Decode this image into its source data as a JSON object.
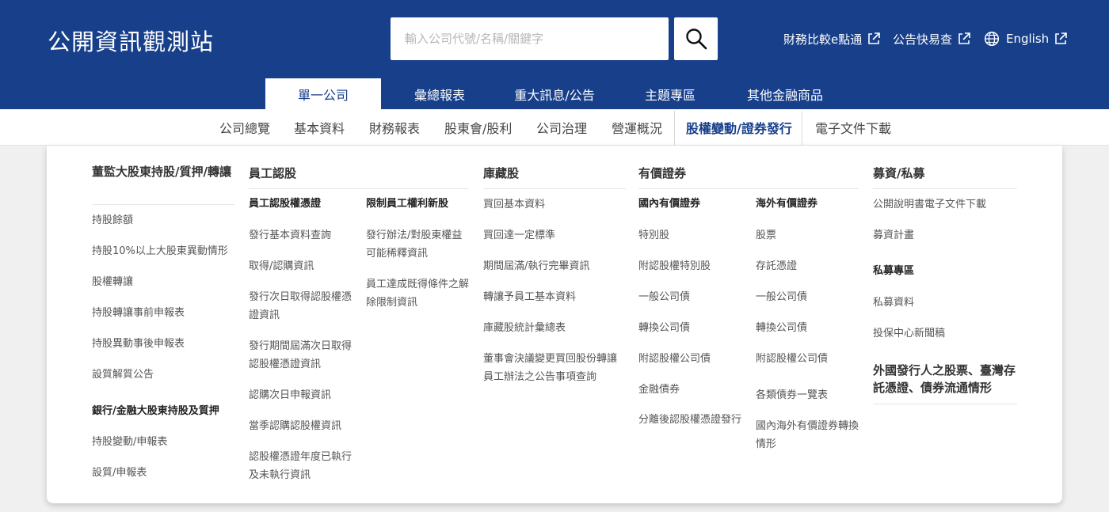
{
  "header": {
    "logo": "公開資訊觀測站",
    "search_placeholder": "輸入公司代號/名稱/關鍵字",
    "links": [
      "財務比較e點通",
      "公告快易查",
      "English"
    ]
  },
  "main_tabs": [
    "單一公司",
    "彙總報表",
    "重大訊息/公告",
    "主題專區",
    "其他金融商品"
  ],
  "sub_tabs": [
    "公司總覽",
    "基本資料",
    "財務報表",
    "股東會/股利",
    "公司治理",
    "營運概況",
    "股權變動/證券發行",
    "電子文件下載"
  ],
  "menu": {
    "col1": {
      "title": "董監大股東持股/質押/轉讓",
      "items": [
        "持股餘額",
        "持股10%以上大股東異動情形",
        "股權轉讓",
        "持股轉讓事前申報表",
        "持股異動事後申報表",
        "設質解質公告"
      ],
      "sub_title": "銀行/金融大股東持股及質押",
      "sub_items": [
        "持股變動/申報表",
        "設質/申報表"
      ]
    },
    "col2": {
      "title": "員工認股",
      "left_title": "員工認股權憑證",
      "left_items": [
        "發行基本資料查詢",
        "取得/認購資訊",
        "發行次日取得認股權憑證資訊",
        "發行期間屆滿次日取得認股權憑證資訊",
        "認購次日申報資訊",
        "當季認購認股權資訊",
        "認股權憑證年度已執行及未執行資訊"
      ],
      "right_title": "限制員工權利新股",
      "right_items": [
        "發行辦法/對股東權益可能稀釋資訊",
        "員工達成既得條件之解除限制資訊"
      ]
    },
    "col3": {
      "title": "庫藏股",
      "items": [
        "買回基本資料",
        "買回達一定標準",
        "期間屆滿/執行完畢資訊",
        "轉讓予員工基本資料",
        "庫藏股統計彙總表",
        "董事會決議變更買回股份轉讓員工辦法之公告事項查詢"
      ]
    },
    "col4": {
      "title": "有價證券",
      "left_title": "國內有價證券",
      "left_items": [
        "特別股",
        "附認股權特別股",
        "一般公司債",
        "轉換公司債",
        "附認股權公司債",
        "金融債券",
        "分離後認股權憑證發行"
      ],
      "right_title": "海外有價證券",
      "right_items": [
        "股票",
        "存託憑證",
        "一般公司債",
        "轉換公司債",
        "附認股權公司債",
        "各類債券一覽表",
        "國內海外有價證券轉換情形"
      ]
    },
    "col5": {
      "title": "募資/私募",
      "items": [
        "公開說明書電子文件下載",
        "募資計畫"
      ],
      "sub_title": "私募專區",
      "sub_items": [
        "私募資料",
        "投保中心新聞稿"
      ],
      "extra_title": "外國發行人之股票、臺灣存託憑證、債券流通情形"
    }
  },
  "colors": {
    "brand": "#173f8a",
    "active_subtab": "#173f8a"
  }
}
